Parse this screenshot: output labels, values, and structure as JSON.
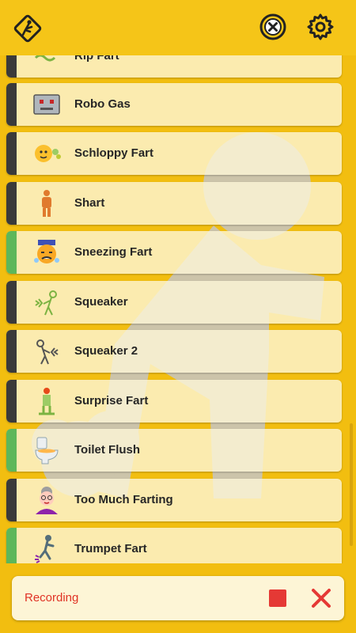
{
  "topbar": {
    "logo_icon": "stick-figure-warning-sign-icon",
    "close_icon": "circled-x-icon",
    "settings_icon": "gear-icon"
  },
  "sounds": [
    {
      "label": "Rip Fart",
      "icon": "rip-fart-icon",
      "stripe": "dark"
    },
    {
      "label": "Robo Gas",
      "icon": "robot-icon",
      "stripe": "dark"
    },
    {
      "label": "Schloppy Fart",
      "icon": "splat-face-icon",
      "stripe": "dark"
    },
    {
      "label": "Shart",
      "icon": "standing-person-icon",
      "stripe": "dark"
    },
    {
      "label": "Sneezing Fart",
      "icon": "sneezing-face-icon",
      "stripe": "green"
    },
    {
      "label": "Squeaker",
      "icon": "stick-person-left-icon",
      "stripe": "dark"
    },
    {
      "label": "Squeaker 2",
      "icon": "stick-person-right-icon",
      "stripe": "dark"
    },
    {
      "label": "Surprise Fart",
      "icon": "green-figure-icon",
      "stripe": "dark"
    },
    {
      "label": "Toilet Flush",
      "icon": "toilet-icon",
      "stripe": "green"
    },
    {
      "label": "Too Much Farting",
      "icon": "grandma-icon",
      "stripe": "dark"
    },
    {
      "label": "Trumpet Fart",
      "icon": "trumpet-figure-icon",
      "stripe": "green"
    }
  ],
  "recording": {
    "label": "Recording",
    "stop_icon": "stop-square-icon",
    "cancel_icon": "red-x-icon"
  },
  "colors": {
    "background": "#F2BE10",
    "stripe_dark": "#3A3A3A",
    "stripe_green": "#5DB75A",
    "recording_red": "#E03225"
  }
}
